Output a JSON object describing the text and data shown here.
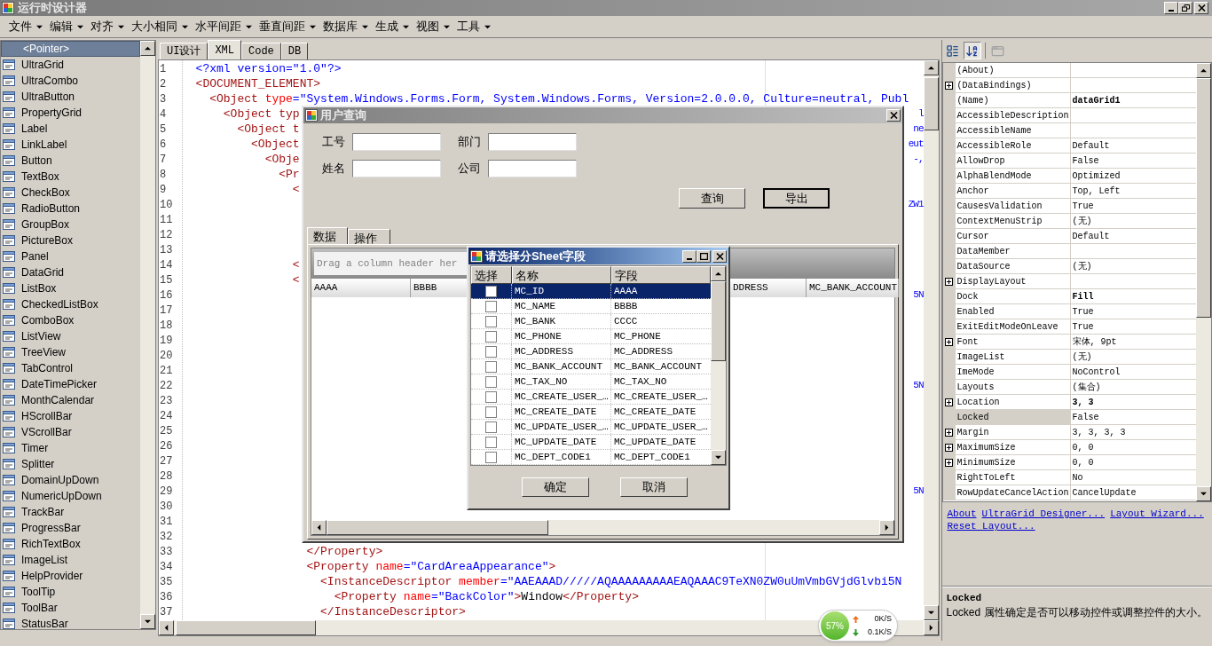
{
  "window": {
    "title": "运行时设计器"
  },
  "menu": [
    "文件",
    "编辑",
    "对齐",
    "大小相同",
    "水平间距",
    "垂直间距",
    "数据库",
    "生成",
    "视图",
    "工具"
  ],
  "toolbox": [
    {
      "label": "<Pointer>",
      "selected": true
    },
    {
      "label": "UltraGrid",
      "selected": false
    },
    {
      "label": "UltraCombo",
      "selected": false
    },
    {
      "label": "UltraButton",
      "selected": false
    },
    {
      "label": "PropertyGrid",
      "selected": false
    },
    {
      "label": "Label",
      "selected": false
    },
    {
      "label": "LinkLabel",
      "selected": false
    },
    {
      "label": "Button",
      "selected": false
    },
    {
      "label": "TextBox",
      "selected": false
    },
    {
      "label": "CheckBox",
      "selected": false
    },
    {
      "label": "RadioButton",
      "selected": false
    },
    {
      "label": "GroupBox",
      "selected": false
    },
    {
      "label": "PictureBox",
      "selected": false
    },
    {
      "label": "Panel",
      "selected": false
    },
    {
      "label": "DataGrid",
      "selected": false
    },
    {
      "label": "ListBox",
      "selected": false
    },
    {
      "label": "CheckedListBox",
      "selected": false
    },
    {
      "label": "ComboBox",
      "selected": false
    },
    {
      "label": "ListView",
      "selected": false
    },
    {
      "label": "TreeView",
      "selected": false
    },
    {
      "label": "TabControl",
      "selected": false
    },
    {
      "label": "DateTimePicker",
      "selected": false
    },
    {
      "label": "MonthCalendar",
      "selected": false
    },
    {
      "label": "HScrollBar",
      "selected": false
    },
    {
      "label": "VScrollBar",
      "selected": false
    },
    {
      "label": "Timer",
      "selected": false
    },
    {
      "label": "Splitter",
      "selected": false
    },
    {
      "label": "DomainUpDown",
      "selected": false
    },
    {
      "label": "NumericUpDown",
      "selected": false
    },
    {
      "label": "TrackBar",
      "selected": false
    },
    {
      "label": "ProgressBar",
      "selected": false
    },
    {
      "label": "RichTextBox",
      "selected": false
    },
    {
      "label": "ImageList",
      "selected": false
    },
    {
      "label": "HelpProvider",
      "selected": false
    },
    {
      "label": "ToolTip",
      "selected": false
    },
    {
      "label": "ToolBar",
      "selected": false
    },
    {
      "label": "StatusBar",
      "selected": false
    }
  ],
  "editor_tabs": [
    {
      "label": "UI设计",
      "selected": false
    },
    {
      "label": "XML",
      "selected": true
    },
    {
      "label": "Code",
      "selected": false
    },
    {
      "label": "DB",
      "selected": false
    }
  ],
  "code_lines": [
    {
      "n": "1",
      "code": "  <?xml version=\"1.0\"?>"
    },
    {
      "n": "2",
      "code": "  <DOCUMENT_ELEMENT>"
    },
    {
      "n": "3",
      "code": "    <Object type=\"System.Windows.Forms.Form, System.Windows.Forms, Version=2.0.0.0, Culture=neutral, Publ"
    },
    {
      "n": "4",
      "code": "      <Object typ",
      "right": "l"
    },
    {
      "n": "5",
      "code": "        <Object t",
      "right": "ne"
    },
    {
      "n": "6",
      "code": "          <Object",
      "right": "eut"
    },
    {
      "n": "7",
      "code": "            <Obje",
      "right": "-,"
    },
    {
      "n": "8",
      "code": "              <Pr"
    },
    {
      "n": "9",
      "code": "                <"
    },
    {
      "n": "10",
      "right": "ZW1"
    },
    {
      "n": "11"
    },
    {
      "n": "12"
    },
    {
      "n": "13"
    },
    {
      "n": "14",
      "code": "                <"
    },
    {
      "n": "15",
      "code": "                <"
    },
    {
      "n": "16",
      "right": "5N"
    },
    {
      "n": "17"
    },
    {
      "n": "18"
    },
    {
      "n": "19"
    },
    {
      "n": "20"
    },
    {
      "n": "21"
    },
    {
      "n": "22",
      "right": "5N"
    },
    {
      "n": "23"
    },
    {
      "n": "24"
    },
    {
      "n": "25"
    },
    {
      "n": "26"
    },
    {
      "n": "27"
    },
    {
      "n": "28"
    },
    {
      "n": "29",
      "right": "5N"
    },
    {
      "n": "30"
    },
    {
      "n": "31"
    },
    {
      "n": "32"
    },
    {
      "n": "33",
      "code": "                  </Property>"
    },
    {
      "n": "34",
      "code": "                  <Property name=\"CardAreaAppearance\">"
    },
    {
      "n": "35",
      "code": "                    <InstanceDescriptor member=\"AAEAAAD/////AQAAAAAAAAAEAQAAAC9TeXN0ZW0uUmVmbGVjdGlvbi5N"
    },
    {
      "n": "36",
      "code": "                      <Property name=\"BackColor\">Window</Property>"
    },
    {
      "n": "37",
      "code": "                    </InstanceDescriptor>"
    }
  ],
  "query_dialog": {
    "title": "用户查询",
    "fields": [
      {
        "label": "工号"
      },
      {
        "label": "部门"
      },
      {
        "label": "姓名"
      },
      {
        "label": "公司"
      }
    ],
    "buttons": [
      {
        "label": "查询",
        "default": false
      },
      {
        "label": "导出",
        "default": true
      }
    ],
    "tabs": [
      {
        "label": "数据",
        "selected": true
      },
      {
        "label": "操作",
        "selected": false
      }
    ],
    "group_by_placeholder": "Drag a column header her",
    "columns": [
      "AAAA",
      "BBBB",
      "DDRESS",
      "MC_BANK_ACCOUNT"
    ]
  },
  "field_dialog": {
    "title": "请选择分Sheet字段",
    "columns": [
      "选择",
      "名称",
      "字段"
    ],
    "rows": [
      {
        "name": "MC_ID",
        "field": "AAAA",
        "checked": false,
        "selected": true
      },
      {
        "name": "MC_NAME",
        "field": "BBBB",
        "checked": false,
        "selected": false
      },
      {
        "name": "MC_BANK",
        "field": "CCCC",
        "checked": false,
        "selected": false
      },
      {
        "name": "MC_PHONE",
        "field": "MC_PHONE",
        "checked": false,
        "selected": false
      },
      {
        "name": "MC_ADDRESS",
        "field": "MC_ADDRESS",
        "checked": false,
        "selected": false
      },
      {
        "name": "MC_BANK_ACCOUNT",
        "field": "MC_BANK_ACCOUNT",
        "checked": false,
        "selected": false
      },
      {
        "name": "MC_TAX_NO",
        "field": "MC_TAX_NO",
        "checked": false,
        "selected": false
      },
      {
        "name": "MC_CREATE_USER_…",
        "field": "MC_CREATE_USER_…",
        "checked": false,
        "selected": false
      },
      {
        "name": "MC_CREATE_DATE",
        "field": "MC_CREATE_DATE",
        "checked": false,
        "selected": false
      },
      {
        "name": "MC_UPDATE_USER_…",
        "field": "MC_UPDATE_USER_…",
        "checked": false,
        "selected": false
      },
      {
        "name": "MC_UPDATE_DATE",
        "field": "MC_UPDATE_DATE",
        "checked": false,
        "selected": false
      },
      {
        "name": "MC_DEPT_CODE1",
        "field": "MC_DEPT_CODE1",
        "checked": false,
        "selected": false
      }
    ],
    "buttons": [
      "确定",
      "取消"
    ]
  },
  "net_monitor": {
    "percent": "57%",
    "upload": "0K/S",
    "download": "0.1K/S"
  },
  "properties": [
    {
      "name": "(About)",
      "expandable": false,
      "selected": false
    },
    {
      "name": "(DataBindings)",
      "expandable": true,
      "selected": false
    },
    {
      "name": "(Name)",
      "value": "dataGrid1",
      "expandable": false,
      "bold": true,
      "selected": false
    },
    {
      "name": "AccessibleDescription",
      "expandable": false,
      "selected": false
    },
    {
      "name": "AccessibleName",
      "expandable": false,
      "selected": false
    },
    {
      "name": "AccessibleRole",
      "value": "Default",
      "expandable": false,
      "bold": false,
      "selected": false
    },
    {
      "name": "AllowDrop",
      "value": "False",
      "expandable": false,
      "bold": false,
      "selected": false
    },
    {
      "name": "AlphaBlendMode",
      "value": "Optimized",
      "expandable": false,
      "bold": false,
      "selected": false
    },
    {
      "name": "Anchor",
      "value": "Top, Left",
      "expandable": false,
      "bold": false,
      "selected": false
    },
    {
      "name": "CausesValidation",
      "value": "True",
      "expandable": false,
      "bold": false,
      "selected": false
    },
    {
      "name": "ContextMenuStrip",
      "value": "(无)",
      "expandable": false,
      "bold": false,
      "selected": false
    },
    {
      "name": "Cursor",
      "value": "Default",
      "expandable": false,
      "bold": false,
      "selected": false
    },
    {
      "name": "DataMember",
      "expandable": false,
      "selected": false
    },
    {
      "name": "DataSource",
      "value": "(无)",
      "expandable": false,
      "bold": false,
      "selected": false
    },
    {
      "name": "DisplayLayout",
      "expandable": true,
      "selected": false
    },
    {
      "name": "Dock",
      "value": "Fill",
      "expandable": false,
      "bold": true,
      "selected": false
    },
    {
      "name": "Enabled",
      "value": "True",
      "expandable": false,
      "bold": false,
      "selected": false
    },
    {
      "name": "ExitEditModeOnLeave",
      "value": "True",
      "expandable": false,
      "bold": false,
      "selected": false
    },
    {
      "name": "Font",
      "value": "宋体, 9pt",
      "expandable": true,
      "bold": false,
      "selected": false
    },
    {
      "name": "ImageList",
      "value": "(无)",
      "expandable": false,
      "bold": false,
      "selected": false
    },
    {
      "name": "ImeMode",
      "value": "NoControl",
      "expandable": false,
      "bold": false,
      "selected": false
    },
    {
      "name": "Layouts",
      "value": "(集合)",
      "expandable": false,
      "bold": false,
      "selected": false
    },
    {
      "name": "Location",
      "value": "3, 3",
      "expandable": true,
      "bold": true,
      "selected": false
    },
    {
      "name": "Locked",
      "value": "False",
      "expandable": false,
      "bold": false,
      "selected": true
    },
    {
      "name": "Margin",
      "value": "3, 3, 3, 3",
      "expandable": true,
      "bold": false,
      "selected": false
    },
    {
      "name": "MaximumSize",
      "value": "0, 0",
      "expandable": true,
      "bold": false,
      "selected": false
    },
    {
      "name": "MinimumSize",
      "value": "0, 0",
      "expandable": true,
      "bold": false,
      "selected": false
    },
    {
      "name": "RightToLeft",
      "value": "No",
      "expandable": false,
      "bold": false,
      "selected": false
    },
    {
      "name": "RowUpdateCancelAction",
      "value": "CancelUpdate",
      "expandable": false,
      "bold": false,
      "selected": false
    }
  ],
  "verbs": [
    "About",
    "UltraGrid Designer...",
    "Layout Wizard...",
    "Reset Layout..."
  ],
  "description": {
    "title": "Locked",
    "text": "Locked 属性确定是否可以移动控件或调整控件的大小。"
  }
}
